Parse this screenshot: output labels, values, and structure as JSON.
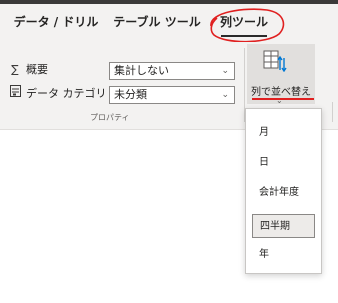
{
  "tabs": [
    {
      "label": "データ / ドリル"
    },
    {
      "label": "テーブル ツール"
    },
    {
      "label": "列ツール",
      "active": true,
      "annotation": "red-circle"
    }
  ],
  "properties": {
    "summary_label": "概要",
    "summary_value": "集計しない",
    "category_label": "データ カテゴリ",
    "category_value": "未分類",
    "group_label": "プロパティ"
  },
  "sort": {
    "button_label": "列で並べ替え",
    "menu": [
      "月",
      "日",
      "会計年度",
      "四半期",
      "年"
    ],
    "selected": "四半期"
  },
  "colors": {
    "annotation_red": "#e02020",
    "ribbon_bg": "#f3f2f1"
  }
}
